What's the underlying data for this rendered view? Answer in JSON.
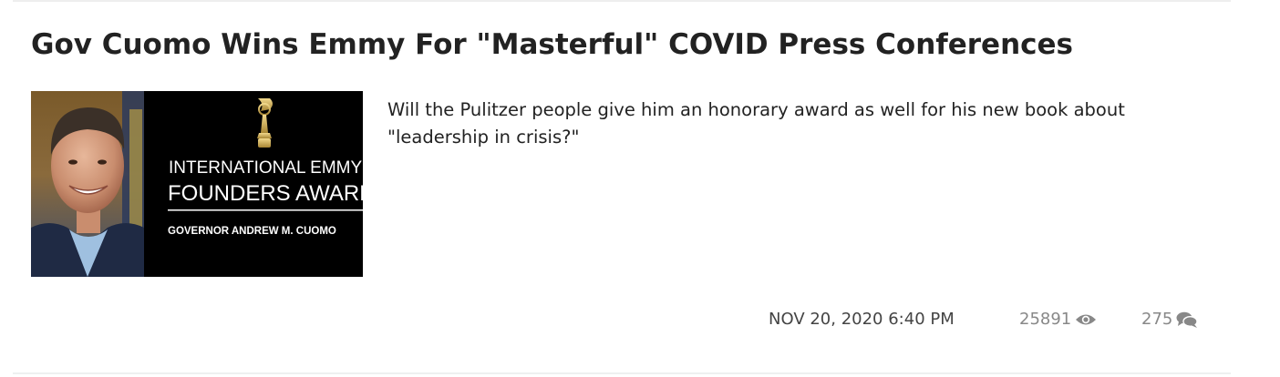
{
  "article": {
    "headline": "Gov Cuomo Wins Emmy For \"Masterful\" COVID Press Conferences",
    "teaser": "Will the Pulitzer people give him an honorary award as well for his new book about \"leadership in crisis?\"",
    "thumbnail": {
      "line1": "INTERNATIONAL EMMY",
      "line2": "FOUNDERS AWARD",
      "line3": "GOVERNOR ANDREW M. CUOMO"
    },
    "date": "NOV 20, 2020 6:40 PM",
    "views": "25891",
    "comments": "275",
    "icons": {
      "views": "eye-icon",
      "comments": "comments-icon"
    }
  },
  "colors": {
    "text": "#222222",
    "meta_date": "#444444",
    "meta_counts": "#888888",
    "thumbnail_bg": "#000000",
    "divider": "#eeeeee"
  }
}
